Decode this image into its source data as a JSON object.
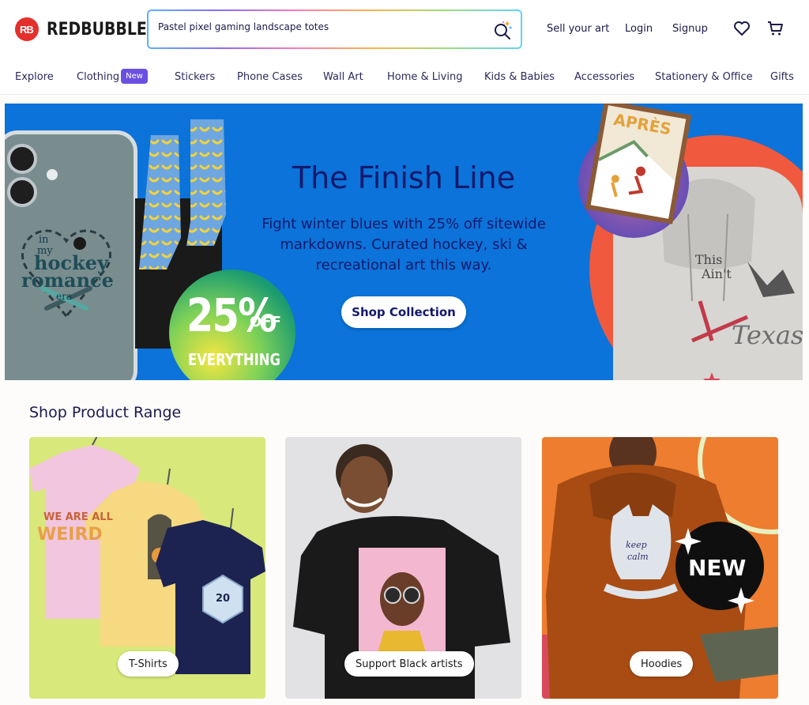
{
  "header": {
    "logo_mark": "RB",
    "logo_text": "REDBUBBLE",
    "search_value": "Pastel pixel gaming landscape totes",
    "sell": "Sell your art",
    "login": "Login",
    "signup": "Signup"
  },
  "categories": [
    {
      "label": "Explore"
    },
    {
      "label": "Clothing",
      "badge": "New"
    },
    {
      "label": "Stickers"
    },
    {
      "label": "Phone Cases"
    },
    {
      "label": "Wall Art"
    },
    {
      "label": "Home & Living"
    },
    {
      "label": "Kids & Babies"
    },
    {
      "label": "Accessories"
    },
    {
      "label": "Stationery & Office"
    },
    {
      "label": "Gifts"
    }
  ],
  "hero": {
    "title": "The Finish Line",
    "subtitle": "Fight winter blues with 25% off sitewide markdowns. Curated hockey, ski & recreational art this way.",
    "button": "Shop Collection",
    "promo_pct": "25%",
    "promo_off": "OFF",
    "promo_all": "EVERYTHING",
    "phone_text_1": "in",
    "phone_text_2": "my",
    "phone_text_3": "hockey",
    "phone_text_4": "romance",
    "phone_text_5": "era",
    "poster_title": "APRÈS",
    "hoodie_text_1": "This",
    "hoodie_text_2": "Ain't",
    "hoodie_text_3": "Texas"
  },
  "product_range": {
    "title": "Shop Product Range",
    "cards": [
      {
        "label": "T-Shirts",
        "tee_text": "WE ARE ALL WEIRD",
        "dice": "20"
      },
      {
        "label": "Support Black artists"
      },
      {
        "label": "Hoodies",
        "art_text": "keep calm",
        "badge": "NEW"
      }
    ]
  },
  "colors": {
    "brand_red": "#e4302c",
    "hero_blue": "#0b73d9",
    "navy_text": "#14196b",
    "badge_purple": "#6b4fe0"
  }
}
